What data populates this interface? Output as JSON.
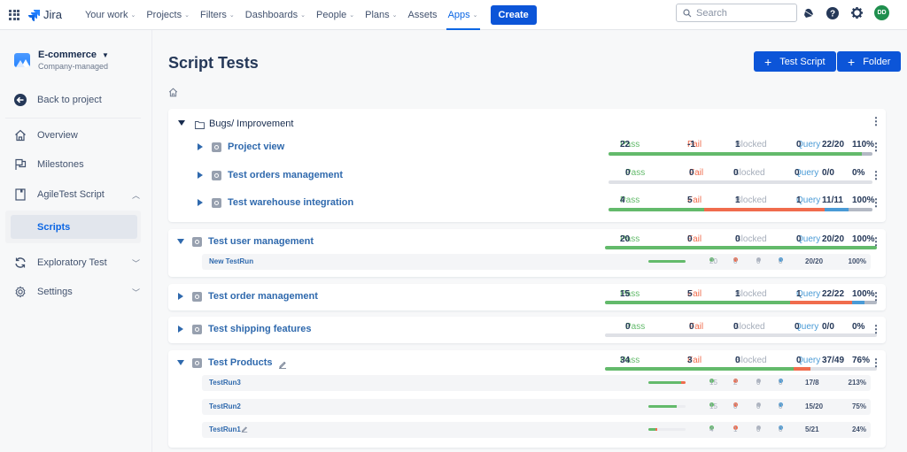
{
  "topnav": {
    "logo_text": "Jira",
    "items": [
      {
        "label": "Your work",
        "has_chevron": true
      },
      {
        "label": "Projects",
        "has_chevron": true
      },
      {
        "label": "Filters",
        "has_chevron": true
      },
      {
        "label": "Dashboards",
        "has_chevron": true
      },
      {
        "label": "People",
        "has_chevron": true
      },
      {
        "label": "Plans",
        "has_chevron": true
      },
      {
        "label": "Assets",
        "has_chevron": false
      },
      {
        "label": "Apps",
        "has_chevron": true,
        "active": true
      }
    ],
    "create_label": "Create",
    "search_placeholder": "Search",
    "avatar_initials": "DD"
  },
  "sidebar": {
    "project_name": "E-commerce",
    "project_type": "Company-managed",
    "back_label": "Back to project",
    "items": [
      {
        "label": "Overview",
        "icon": "home-icon"
      },
      {
        "label": "Milestones",
        "icon": "flag-icon"
      },
      {
        "label": "AgileTest Script",
        "icon": "document-icon",
        "chevron": "up"
      },
      {
        "label": "Scripts",
        "active": true
      },
      {
        "label": "Exploratory Test",
        "icon": "refresh-icon",
        "chevron": "down"
      },
      {
        "label": "Settings",
        "icon": "gear-icon",
        "chevron": "down"
      }
    ]
  },
  "main": {
    "title": "Script Tests",
    "test_script_button": "Test Script",
    "folder_button": "Folder",
    "labels": {
      "pass": "Pass",
      "fail": "Fail",
      "blocked": "Blocked",
      "query": "Query"
    },
    "folder": {
      "name": "Bugs/ Improvement",
      "scripts": [
        {
          "name": "Project view",
          "pass": "22",
          "fail": "-1",
          "blocked": "1",
          "query": "0",
          "ratio": "22/20",
          "percent": "110%",
          "bar": {
            "pass": 0.96,
            "fail": 0,
            "query": 0,
            "blocked": 0.04
          }
        },
        {
          "name": "Test orders management",
          "pass": "0",
          "fail": "0",
          "blocked": "0",
          "query": "0",
          "ratio": "0/0",
          "percent": "0%",
          "bar": {
            "pass": 0,
            "fail": 0,
            "query": 0,
            "blocked": 0
          }
        },
        {
          "name": "Test warehouse integration",
          "pass": "4",
          "fail": "5",
          "blocked": "1",
          "query": "1",
          "ratio": "11/11",
          "percent": "100%",
          "bar": {
            "pass": 0.364,
            "fail": 0.455,
            "query": 0.091,
            "blocked": 0.091
          }
        }
      ]
    },
    "scripts": [
      {
        "name": "Test user management",
        "expanded": true,
        "pass": "20",
        "fail": "0",
        "blocked": "0",
        "query": "0",
        "ratio": "20/20",
        "percent": "100%",
        "bar": {
          "pass": 1,
          "fail": 0,
          "query": 0,
          "blocked": 0
        },
        "runs": [
          {
            "name": "New TestRun",
            "pass": "20",
            "fail": "0",
            "blocked": "0",
            "query": "0",
            "ratio": "20/20",
            "percent": "100%",
            "bar": {
              "pass": 1,
              "fail": 0
            }
          }
        ]
      },
      {
        "name": "Test order management",
        "expanded": false,
        "pass": "15",
        "fail": "5",
        "blocked": "1",
        "query": "1",
        "ratio": "22/22",
        "percent": "100%",
        "bar": {
          "pass": 0.682,
          "fail": 0.227,
          "query": 0.045,
          "blocked": 0.045
        }
      },
      {
        "name": "Test shipping features",
        "expanded": false,
        "pass": "0",
        "fail": "0",
        "blocked": "0",
        "query": "0",
        "ratio": "0/0",
        "percent": "0%",
        "bar": {
          "pass": 0,
          "fail": 0,
          "query": 0,
          "blocked": 0
        }
      },
      {
        "name": "Test Products",
        "expanded": true,
        "editable": true,
        "pass": "34",
        "fail": "3",
        "blocked": "0",
        "query": "0",
        "ratio": "37/49",
        "percent": "76%",
        "bar": {
          "pass": 0.694,
          "fail": 0.061,
          "query": 0,
          "blocked": 0
        },
        "runs": [
          {
            "name": "TestRun3",
            "pass": "15",
            "fail": "2",
            "blocked": "0",
            "query": "0",
            "ratio": "17/8",
            "percent": "213%",
            "bar": {
              "pass": 0.88,
              "fail": 0.12
            }
          },
          {
            "name": "TestRun2",
            "pass": "15",
            "fail": "0",
            "blocked": "0",
            "query": "0",
            "ratio": "15/20",
            "percent": "75%",
            "bar": {
              "pass": 0.75,
              "fail": 0
            }
          },
          {
            "name": "TestRun1",
            "editable": true,
            "pass": "4",
            "fail": "1",
            "blocked": "0",
            "query": "0",
            "ratio": "5/21",
            "percent": "24%",
            "bar": {
              "pass": 0.19,
              "fail": 0.05
            }
          }
        ]
      }
    ]
  },
  "colors": {
    "pass": "#63ba6b",
    "fail": "#f06c4d",
    "blocked": "#b3b9c4",
    "query": "#4a9bd6",
    "primary": "#0c55d8",
    "link": "#2f69ad"
  }
}
